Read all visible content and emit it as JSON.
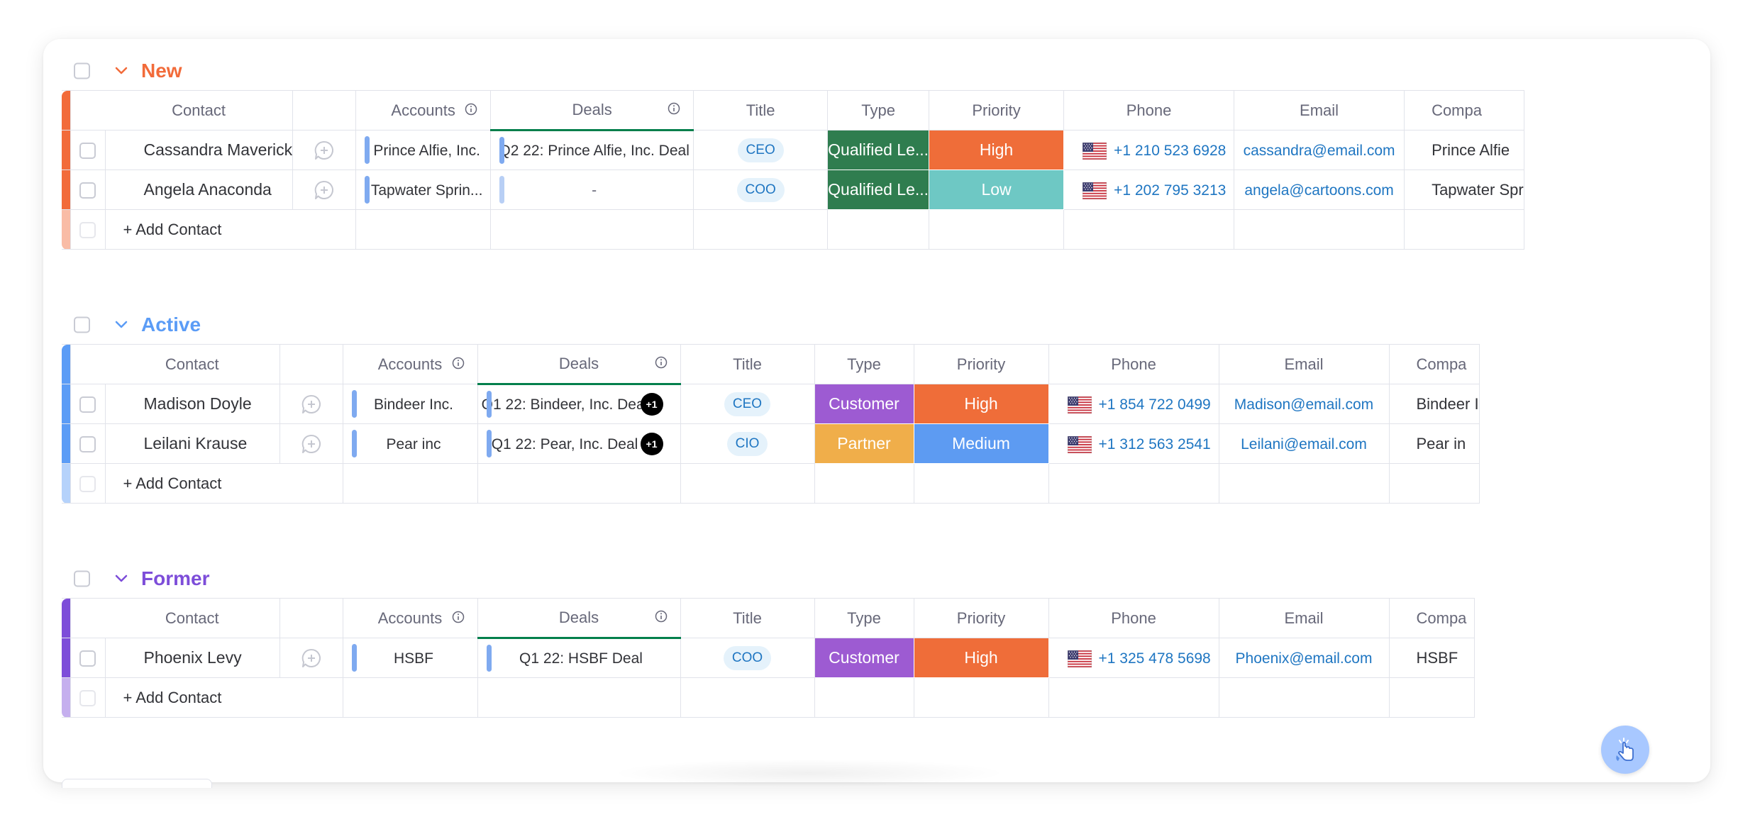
{
  "columns": {
    "contact": "Contact",
    "accounts": "Accounts",
    "deals": "Deals",
    "title": "Title",
    "type": "Type",
    "priority": "Priority",
    "phone": "Phone",
    "email": "Email",
    "company": "Compa"
  },
  "add_contact_label": "+ Add Contact",
  "colors": {
    "new": "#f26b3a",
    "active": "#5b9cf6",
    "former": "#7d4dd9",
    "accounts_bar": "#7faaf0",
    "deals_bar": "#7faaf0",
    "deals_header_underline": "#037f4c",
    "type_qualified": "#2f7d4f",
    "type_customer": "#9d5bd2",
    "type_partner": "#f0ae4a",
    "priority_high": "#ef6d39",
    "priority_low": "#6ec8c4",
    "priority_medium": "#5d9bf2",
    "link": "#1f76c2"
  },
  "groups": [
    {
      "key": "new",
      "name": "New",
      "rows": [
        {
          "contact": "Cassandra Maverick",
          "account": "Prince Alfie, Inc.",
          "deal": "Q2 22: Prince Alfie, Inc. Deal",
          "deal_extra": "",
          "title": "CEO",
          "type": "Qualified Le...",
          "type_color": "#2f7d4f",
          "priority": "High",
          "priority_color": "#ef6d39",
          "phone": "+1 210 523 6928",
          "email": "cassandra@email.com",
          "company": "Prince Alfie"
        },
        {
          "contact": "Angela Anaconda",
          "account": "Tapwater Sprin...",
          "deal": "-",
          "deal_extra": "",
          "title": "COO",
          "type": "Qualified Le...",
          "type_color": "#2f7d4f",
          "priority": "Low",
          "priority_color": "#6ec8c4",
          "phone": "+1 202 795 3213",
          "email": "angela@cartoons.com",
          "company": "Tapwater Spr"
        }
      ]
    },
    {
      "key": "active",
      "name": "Active",
      "rows": [
        {
          "contact": "Madison Doyle",
          "account": "Bindeer Inc.",
          "deal": "Q1 22: Bindeer, Inc. Deal",
          "deal_extra": "+1",
          "title": "CEO",
          "type": "Customer",
          "type_color": "#9d5bd2",
          "priority": "High",
          "priority_color": "#ef6d39",
          "phone": "+1 854 722 0499",
          "email": "Madison@email.com",
          "company": "Bindeer I"
        },
        {
          "contact": "Leilani Krause",
          "account": "Pear inc",
          "deal": "Q1 22: Pear, Inc. Deal",
          "deal_extra": "+1",
          "title": "CIO",
          "type": "Partner",
          "type_color": "#f0ae4a",
          "priority": "Medium",
          "priority_color": "#5d9bf2",
          "phone": "+1 312 563 2541",
          "email": "Leilani@email.com",
          "company": "Pear in"
        }
      ]
    },
    {
      "key": "former",
      "name": "Former",
      "rows": [
        {
          "contact": "Phoenix Levy",
          "account": "HSBF",
          "deal": "Q1 22: HSBF Deal",
          "deal_extra": "",
          "title": "COO",
          "type": "Customer",
          "type_color": "#9d5bd2",
          "priority": "High",
          "priority_color": "#ef6d39",
          "phone": "+1 325 478 5698",
          "email": "Phoenix@email.com",
          "company": "HSBF"
        }
      ]
    }
  ]
}
